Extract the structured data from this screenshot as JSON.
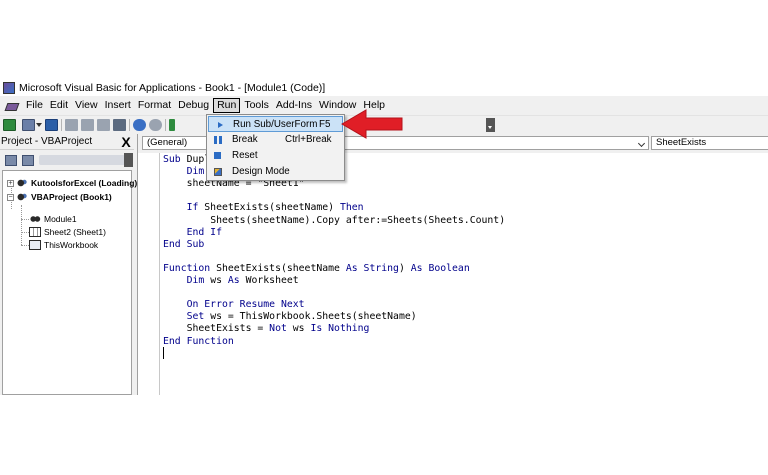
{
  "window": {
    "title": "Microsoft Visual Basic for Applications - Book1 - [Module1 (Code)]"
  },
  "menubar": {
    "items": [
      {
        "label": "File"
      },
      {
        "label": "Edit"
      },
      {
        "label": "View"
      },
      {
        "label": "Insert"
      },
      {
        "label": "Format"
      },
      {
        "label": "Debug"
      },
      {
        "label": "Run"
      },
      {
        "label": "Tools"
      },
      {
        "label": "Add-Ins"
      },
      {
        "label": "Window"
      },
      {
        "label": "Help"
      }
    ],
    "active": "Run"
  },
  "run_menu": {
    "items": [
      {
        "label": "Run Sub/UserForm",
        "shortcut": "F5",
        "icon": "play-icon"
      },
      {
        "label": "Break",
        "shortcut": "Ctrl+Break",
        "icon": "pause-icon"
      },
      {
        "label": "Reset",
        "shortcut": "",
        "icon": "stop-icon"
      },
      {
        "label": "Design Mode",
        "shortcut": "",
        "icon": "design-mode-icon"
      }
    ]
  },
  "project": {
    "title": "Project - VBAProject",
    "close_label": "X",
    "tree": [
      {
        "label": "KutoolsforExcel (Loading)",
        "bold": true
      },
      {
        "label": "VBAProject (Book1)",
        "bold": true
      },
      {
        "label": "Module1",
        "bold": false
      },
      {
        "label": "Sheet2 (Sheet1)",
        "bold": false
      },
      {
        "label": "ThisWorkbook",
        "bold": false
      }
    ]
  },
  "code": {
    "object_combo": "(General)",
    "procedure_combo": "SheetExists",
    "lines": [
      {
        "indent": "",
        "parts": [
          {
            "t": "Sub",
            "k": true
          },
          {
            "t": " Dupl",
            "k": false
          }
        ]
      },
      {
        "indent": "    ",
        "parts": [
          {
            "t": "Dim",
            "k": true
          }
        ]
      },
      {
        "indent": "    ",
        "parts": [
          {
            "t": "sheetName = \"Sheet1\"",
            "k": false
          }
        ]
      },
      {
        "indent": "",
        "parts": []
      },
      {
        "indent": "    ",
        "parts": [
          {
            "t": "If",
            "k": true
          },
          {
            "t": " SheetExists(sheetName) ",
            "k": false
          },
          {
            "t": "Then",
            "k": true
          }
        ]
      },
      {
        "indent": "        ",
        "parts": [
          {
            "t": "Sheets(sheetName).Copy after:=Sheets(Sheets.Count)",
            "k": false
          }
        ]
      },
      {
        "indent": "    ",
        "parts": [
          {
            "t": "End If",
            "k": true
          }
        ]
      },
      {
        "indent": "",
        "parts": [
          {
            "t": "End Sub",
            "k": true
          }
        ]
      },
      {
        "indent": "",
        "parts": []
      },
      {
        "indent": "",
        "parts": [
          {
            "t": "Function",
            "k": true
          },
          {
            "t": " SheetExists(sheetName ",
            "k": false
          },
          {
            "t": "As String",
            "k": true
          },
          {
            "t": ") ",
            "k": false
          },
          {
            "t": "As Boolean",
            "k": true
          }
        ]
      },
      {
        "indent": "    ",
        "parts": [
          {
            "t": "Dim",
            "k": true
          },
          {
            "t": " ws ",
            "k": false
          },
          {
            "t": "As",
            "k": true
          },
          {
            "t": " Worksheet",
            "k": false
          }
        ]
      },
      {
        "indent": "",
        "parts": []
      },
      {
        "indent": "    ",
        "parts": [
          {
            "t": "On Error Resume Next",
            "k": true
          }
        ]
      },
      {
        "indent": "    ",
        "parts": [
          {
            "t": "Set",
            "k": true
          },
          {
            "t": " ws = ThisWorkbook.Sheets(sheetName)",
            "k": false
          }
        ]
      },
      {
        "indent": "    ",
        "parts": [
          {
            "t": "SheetExists = ",
            "k": false
          },
          {
            "t": "Not",
            "k": true
          },
          {
            "t": " ws ",
            "k": false
          },
          {
            "t": "Is Nothing",
            "k": true
          }
        ]
      },
      {
        "indent": "",
        "parts": [
          {
            "t": "End Function",
            "k": true
          }
        ]
      }
    ]
  },
  "colors": {
    "keyword": "#00008b",
    "highlight": "#cbe2f7",
    "annotation_arrow": "#e01e26"
  }
}
